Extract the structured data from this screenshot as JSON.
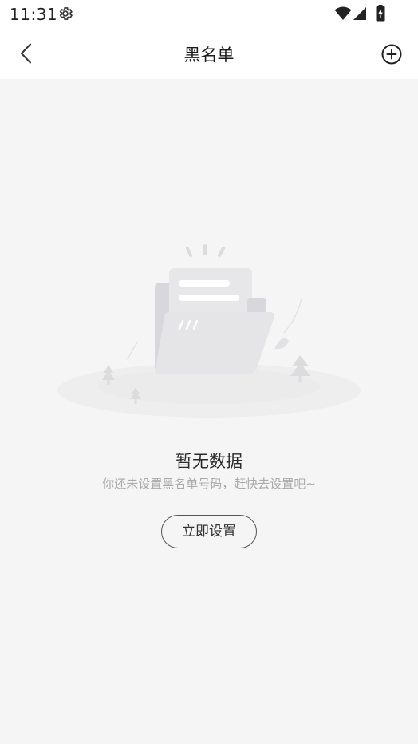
{
  "status_bar": {
    "time": "11:31",
    "icons": [
      "gear-icon",
      "wifi-icon",
      "signal-icon",
      "battery-charging-icon"
    ]
  },
  "nav": {
    "title": "黑名单",
    "back_icon": "chevron-left-icon",
    "add_icon": "plus-circle-icon"
  },
  "empty_state": {
    "illustration": "empty-folder-illustration",
    "title": "暂无数据",
    "description": "你还未设置黑名单号码，赶快去设置吧~",
    "button_label": "立即设置"
  },
  "colors": {
    "background": "#f5f5f5",
    "surface": "#ffffff",
    "text_primary": "#1a1a1a",
    "text_secondary": "#aaaaaa",
    "button_border": "#555555"
  }
}
